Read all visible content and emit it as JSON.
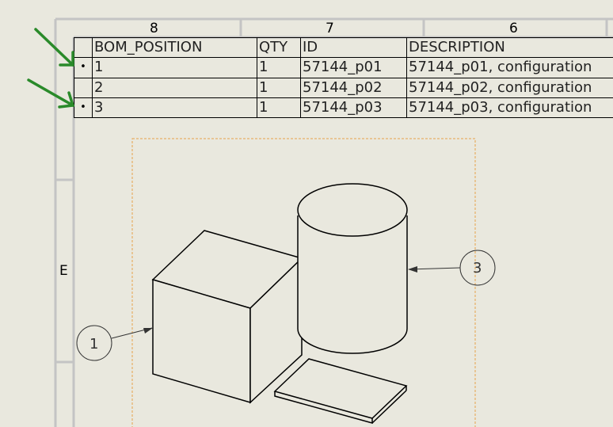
{
  "sheet": {
    "zone_columns": [
      "8",
      "7",
      "6"
    ],
    "zone_row": "E"
  },
  "bom": {
    "headers": {
      "position": "BOM_POSITION",
      "qty": "QTY",
      "id": "ID",
      "description": "DESCRIPTION"
    },
    "rows": [
      {
        "marker": "•",
        "position": "1",
        "qty": "1",
        "id": "57144_p01",
        "description": "57144_p01, configuration"
      },
      {
        "marker": "",
        "position": "2",
        "qty": "1",
        "id": "57144_p02",
        "description": "57144_p02, configuration"
      },
      {
        "marker": "•",
        "position": "3",
        "qty": "1",
        "id": "57144_p03",
        "description": "57144_p03, configuration"
      }
    ]
  },
  "balloons": {
    "b1": "1",
    "b3": "3"
  },
  "colors": {
    "sheet_bg": "#e9e8de",
    "frame": "#c8c8c8",
    "annotation_arrow": "#2a8a2a",
    "view_boundary": "#e8a24a"
  }
}
